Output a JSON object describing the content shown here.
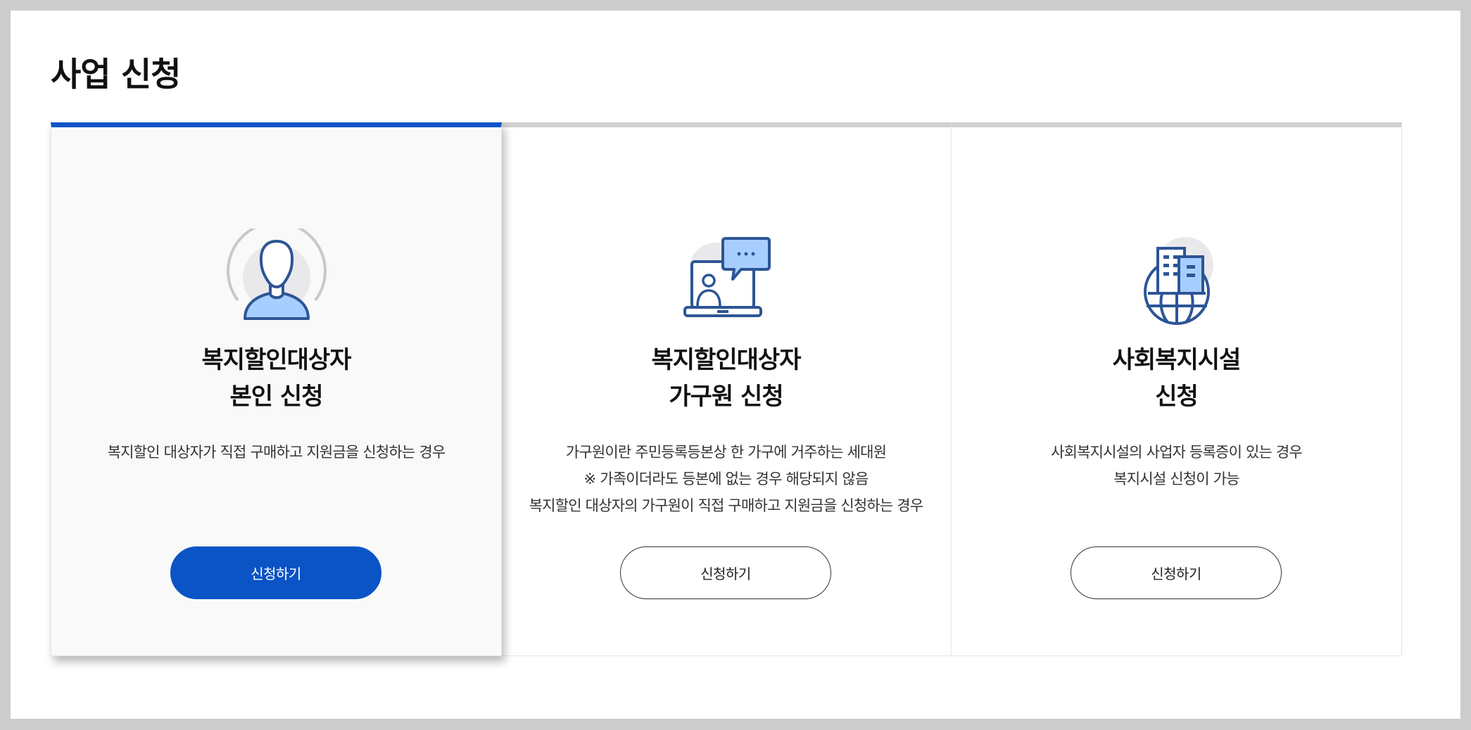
{
  "page": {
    "title": "사업 신청"
  },
  "colors": {
    "accent": "#0b54c6",
    "icon_fill": "#a8ceff",
    "icon_stroke": "#2d5596"
  },
  "cards": [
    {
      "icon": "person-icon",
      "title_line1": "복지할인대상자",
      "title_line2": "본인 신청",
      "desc": [
        "복지할인 대상자가 직접 구매하고 지원금을 신청하는 경우"
      ],
      "button": "신청하기",
      "active": true
    },
    {
      "icon": "laptop-chat-icon",
      "title_line1": "복지할인대상자",
      "title_line2": "가구원 신청",
      "desc": [
        "가구원이란 주민등록등본상 한 가구에 거주하는 세대원",
        "※ 가족이더라도 등본에 없는 경우 해당되지 않음",
        "복지할인 대상자의 가구원이 직접 구매하고 지원금을 신청하는 경우"
      ],
      "button": "신청하기",
      "active": false
    },
    {
      "icon": "building-globe-icon",
      "title_line1": "사회복지시설",
      "title_line2": "신청",
      "desc": [
        "사회복지시설의 사업자 등록증이 있는 경우",
        "복지시설 신청이 가능"
      ],
      "button": "신청하기",
      "active": false
    }
  ]
}
